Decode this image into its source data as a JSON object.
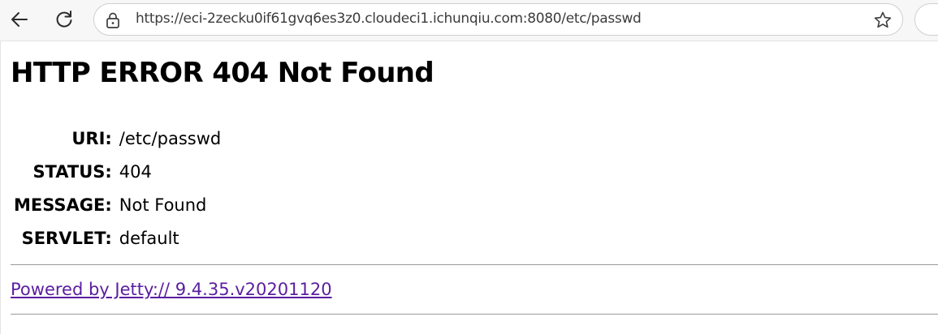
{
  "browser": {
    "url": "https://eci-2zecku0if61gvq6es3z0.cloudeci1.ichunqiu.com:8080/etc/passwd",
    "icons": [
      "back-arrow-icon",
      "reload-icon",
      "lock-icon",
      "star-icon"
    ]
  },
  "page": {
    "title": "HTTP ERROR 404 Not Found",
    "rows": [
      {
        "label": "URI:",
        "value": "/etc/passwd"
      },
      {
        "label": "STATUS:",
        "value": "404"
      },
      {
        "label": "MESSAGE:",
        "value": "Not Found"
      },
      {
        "label": "SERVLET:",
        "value": "default"
      }
    ],
    "footer_link": "Powered by Jetty:// 9.4.35.v20201120"
  },
  "colors": {
    "link": "#5a1ea0",
    "text": "#000000",
    "chrome_background": "#f7f7f7"
  }
}
